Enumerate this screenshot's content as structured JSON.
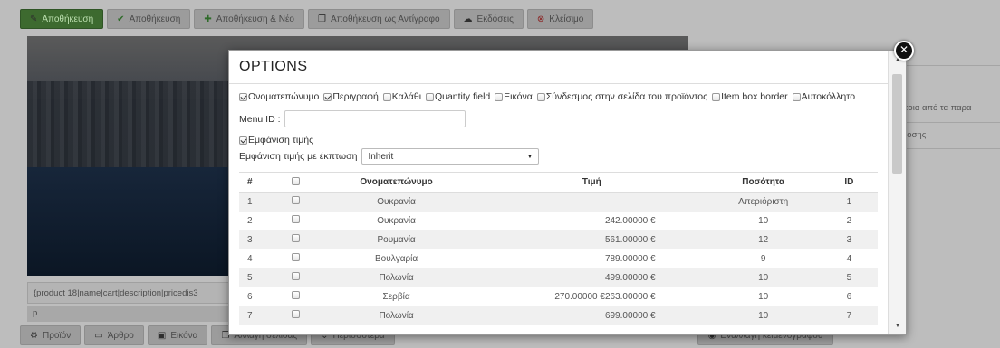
{
  "background": {
    "toolbar": [
      {
        "label": "Αποθήκευση",
        "icon": "edit-icon"
      },
      {
        "label": "Αποθήκευση",
        "icon": "check-icon"
      },
      {
        "label": "Αποθήκευση & Νέο",
        "icon": "plus-icon"
      },
      {
        "label": "Αποθήκευση ως Αντίγραφο",
        "icon": "copy-icon"
      },
      {
        "label": "Εκδόσεις",
        "icon": "versions-icon"
      },
      {
        "label": "Κλείσιμο",
        "icon": "close-circle-icon"
      }
    ],
    "editor_text": "{product 18|name|cart|description|pricedis3",
    "editor_p": "p",
    "bottom_buttons": [
      {
        "label": "Προϊόν",
        "icon": "product-icon"
      },
      {
        "label": "Άρθρο",
        "icon": "article-icon"
      },
      {
        "label": "Εικόνα",
        "icon": "image-icon"
      },
      {
        "label": "Αλλαγή σελίδας",
        "icon": "page-break-icon"
      },
      {
        "label": "Περισσότερα",
        "icon": "chevron-down-icon"
      }
    ],
    "toggle_editor": "Εναλλαγή κειμενογράφου",
    "sidebar": {
      "text1": "ποια από τα παρα",
      "text2": "δοσης"
    }
  },
  "modal": {
    "title": "OPTIONS",
    "options": [
      {
        "label": "Ονοματεπώνυμο",
        "checked": true
      },
      {
        "label": "Περιγραφή",
        "checked": true
      },
      {
        "label": "Καλάθι",
        "checked": false
      },
      {
        "label": "Quantity field",
        "checked": false
      },
      {
        "label": "Εικόνα",
        "checked": false
      },
      {
        "label": "Σύνδεσμος στην σελίδα του προϊόντος",
        "checked": false
      },
      {
        "label": "Item box border",
        "checked": false
      },
      {
        "label": "Αυτοκόλλητο",
        "checked": false
      }
    ],
    "menu_id_label": "Menu ID :",
    "menu_id_value": "",
    "show_price": {
      "label": "Εμφάνιση τιμής",
      "checked": true
    },
    "discount_label": "Εμφάνιση τιμής με έκπτωση",
    "discount_value": "Inherit",
    "table": {
      "headers": {
        "num": "#",
        "name": "Ονοματεπώνυμο",
        "price": "Τιμή",
        "qty": "Ποσότητα",
        "id": "ID"
      },
      "rows": [
        {
          "num": "1",
          "name": "Ουκρανία",
          "price": "",
          "qty": "Απεριόριστη",
          "id": "1"
        },
        {
          "num": "2",
          "name": "Ουκρανία",
          "price": "242.00000 €",
          "qty": "10",
          "id": "2"
        },
        {
          "num": "3",
          "name": "Ρουμανία",
          "price": "561.00000 €",
          "qty": "12",
          "id": "3"
        },
        {
          "num": "4",
          "name": "Βουλγαρία",
          "price": "789.00000 €",
          "qty": "9",
          "id": "4"
        },
        {
          "num": "5",
          "name": "Πολωνία",
          "price": "499.00000 €",
          "qty": "10",
          "id": "5"
        },
        {
          "num": "6",
          "name": "Σερβία",
          "price": "270.00000 €263.00000 €",
          "qty": "10",
          "id": "6"
        },
        {
          "num": "7",
          "name": "Πολωνία",
          "price": "699.00000 €",
          "qty": "10",
          "id": "7"
        }
      ]
    }
  },
  "colors": {
    "save_green": "#3d6a2f",
    "overlay": "#7a7a7a"
  }
}
